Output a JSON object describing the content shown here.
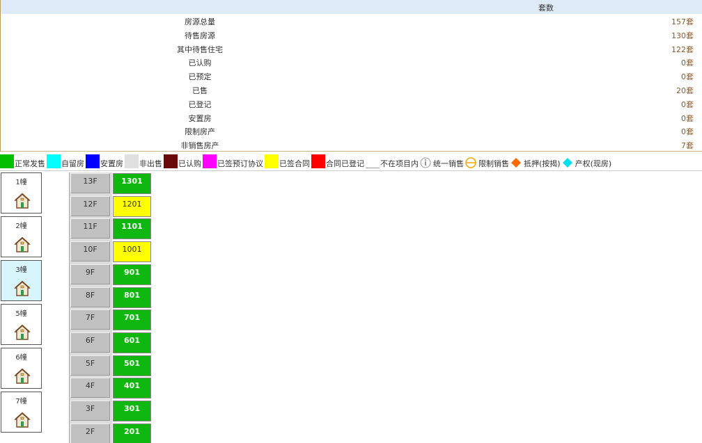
{
  "summary": {
    "header": "套数",
    "rows": [
      {
        "label": "房源总量",
        "value": "157套"
      },
      {
        "label": "待售房源",
        "value": "130套"
      },
      {
        "label": "其中待售住宅",
        "value": "122套"
      },
      {
        "label": "已认购",
        "value": "0套"
      },
      {
        "label": "已预定",
        "value": "0套"
      },
      {
        "label": "已售",
        "value": "20套"
      },
      {
        "label": "已登记",
        "value": "0套"
      },
      {
        "label": "安置房",
        "value": "0套"
      },
      {
        "label": "限制房产",
        "value": "0套"
      },
      {
        "label": "非销售房产",
        "value": "7套"
      }
    ]
  },
  "legend": [
    {
      "label": "正常发售",
      "color": "#00c000",
      "kind": "swatch"
    },
    {
      "label": "自留房",
      "color": "#00ffff",
      "kind": "swatch"
    },
    {
      "label": "安置房",
      "color": "#0000ff",
      "kind": "swatch"
    },
    {
      "label": "非出售",
      "color": "#e0e0e0",
      "kind": "swatch"
    },
    {
      "label": "已认购",
      "color": "#6b0a0a",
      "kind": "swatch"
    },
    {
      "label": "已签预订协议",
      "color": "#ff00ff",
      "kind": "swatch"
    },
    {
      "label": "已签合同",
      "color": "#ffff00",
      "kind": "swatch"
    },
    {
      "label": "合同已登记",
      "color": "#ff0000",
      "kind": "swatch"
    },
    {
      "label": "不在项目内",
      "color": "#ffffff",
      "kind": "swatch"
    },
    {
      "label": "统一销售",
      "icon": "info-circle-icon",
      "kind": "icon"
    },
    {
      "label": "限制销售",
      "icon": "restricted-circle-icon",
      "kind": "icon"
    },
    {
      "label": "抵押(按揭)",
      "icon": "orange-diamond-icon",
      "kind": "icon"
    },
    {
      "label": "产权(现房)",
      "icon": "cyan-diamond-icon",
      "kind": "icon"
    }
  ],
  "buildings": [
    {
      "label": "1幢",
      "active": false
    },
    {
      "label": "2幢",
      "active": false
    },
    {
      "label": "3幢",
      "active": true
    },
    {
      "label": "5幢",
      "active": false
    },
    {
      "label": "6幢",
      "active": false
    },
    {
      "label": "7幢",
      "active": false
    }
  ],
  "floors": [
    {
      "floor": "13F",
      "unit": "1301",
      "status": "green"
    },
    {
      "floor": "12F",
      "unit": "1201",
      "status": "yellow"
    },
    {
      "floor": "11F",
      "unit": "1101",
      "status": "green"
    },
    {
      "floor": "10F",
      "unit": "1001",
      "status": "yellow"
    },
    {
      "floor": "9F",
      "unit": "901",
      "status": "green"
    },
    {
      "floor": "8F",
      "unit": "801",
      "status": "green"
    },
    {
      "floor": "7F",
      "unit": "701",
      "status": "green"
    },
    {
      "floor": "6F",
      "unit": "601",
      "status": "green"
    },
    {
      "floor": "5F",
      "unit": "501",
      "status": "green"
    },
    {
      "floor": "4F",
      "unit": "401",
      "status": "green"
    },
    {
      "floor": "3F",
      "unit": "301",
      "status": "green"
    },
    {
      "floor": "2F",
      "unit": "201",
      "status": "green"
    }
  ]
}
